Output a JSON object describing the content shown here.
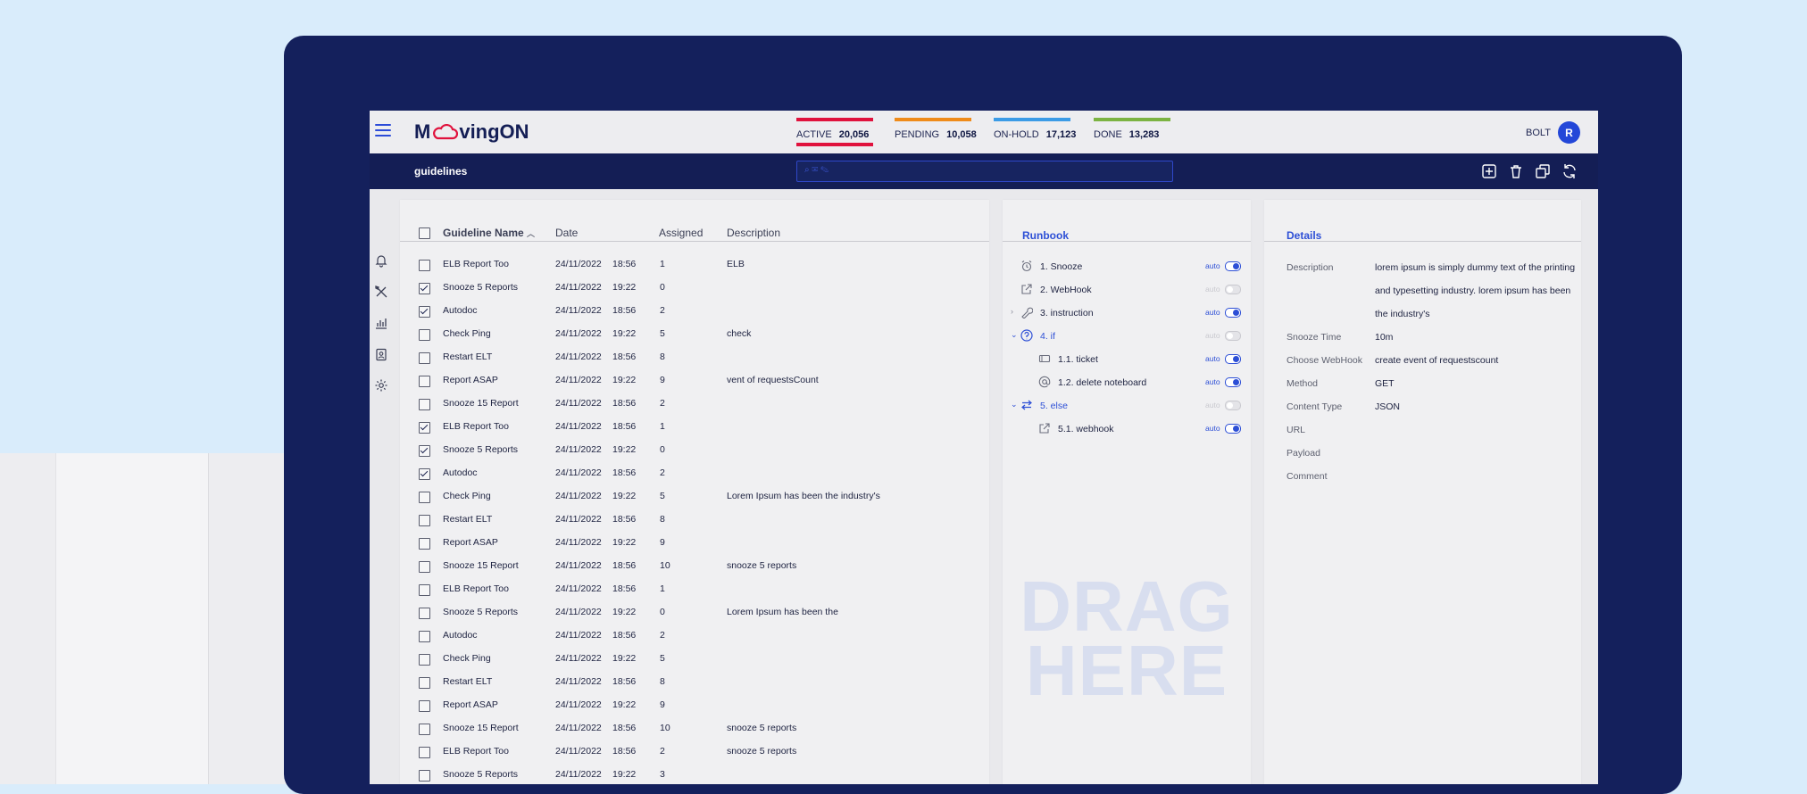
{
  "app": {
    "logo_left": "M",
    "logo_right": "vingON",
    "user": "BOLT",
    "avatar_initial": "R"
  },
  "stats": [
    {
      "label": "ACTIVE",
      "value": "20,056",
      "color": "#e0123d"
    },
    {
      "label": "PENDING",
      "value": "10,058",
      "color": "#ef8b1a"
    },
    {
      "label": "ON-HOLD",
      "value": "17,123",
      "color": "#3b9be6"
    },
    {
      "label": "DONE",
      "value": "13,283",
      "color": "#7cb342"
    }
  ],
  "subbar": {
    "title": "guidelines",
    "search_placeholder": "⌕ ✉ ✎"
  },
  "table": {
    "headers": {
      "name": "Guideline Name",
      "date": "Date",
      "assigned": "Assigned",
      "description": "Description"
    },
    "rows": [
      {
        "name": "ELB Report Too",
        "date": "24/11/2022",
        "time": "18:56",
        "assigned": "1",
        "description": "ELB",
        "checked": false
      },
      {
        "name": "Snooze 5 Reports",
        "date": "24/11/2022",
        "time": "19:22",
        "assigned": "0",
        "description": "",
        "checked": true
      },
      {
        "name": "Autodoc",
        "date": "24/11/2022",
        "time": "18:56",
        "assigned": "2",
        "description": "",
        "checked": true
      },
      {
        "name": "Check Ping",
        "date": "24/11/2022",
        "time": "19:22",
        "assigned": "5",
        "description": "check",
        "checked": false
      },
      {
        "name": "Restart ELT",
        "date": "24/11/2022",
        "time": "18:56",
        "assigned": "8",
        "description": "",
        "checked": false
      },
      {
        "name": "Report ASAP",
        "date": "24/11/2022",
        "time": "19:22",
        "assigned": "9",
        "description": "vent of requestsCount",
        "checked": false
      },
      {
        "name": "Snooze 15 Report",
        "date": "24/11/2022",
        "time": "18:56",
        "assigned": "2",
        "description": "",
        "checked": false
      },
      {
        "name": "ELB Report Too",
        "date": "24/11/2022",
        "time": "18:56",
        "assigned": "1",
        "description": "",
        "checked": true
      },
      {
        "name": "Snooze 5 Reports",
        "date": "24/11/2022",
        "time": "19:22",
        "assigned": "0",
        "description": "",
        "checked": true
      },
      {
        "name": "Autodoc",
        "date": "24/11/2022",
        "time": "18:56",
        "assigned": "2",
        "description": "",
        "checked": true
      },
      {
        "name": "Check Ping",
        "date": "24/11/2022",
        "time": "19:22",
        "assigned": "5",
        "description": " Lorem Ipsum has been the industry's",
        "checked": false
      },
      {
        "name": "Restart ELT",
        "date": "24/11/2022",
        "time": "18:56",
        "assigned": "8",
        "description": "",
        "checked": false
      },
      {
        "name": "Report ASAP",
        "date": "24/11/2022",
        "time": "19:22",
        "assigned": "9",
        "description": "",
        "checked": false
      },
      {
        "name": "Snooze 15 Report",
        "date": "24/11/2022",
        "time": "18:56",
        "assigned": "10",
        "description": "snooze 5 reports",
        "checked": false
      },
      {
        "name": "ELB Report Too",
        "date": "24/11/2022",
        "time": "18:56",
        "assigned": "1",
        "description": "",
        "checked": false
      },
      {
        "name": "Snooze 5 Reports",
        "date": "24/11/2022",
        "time": "19:22",
        "assigned": "0",
        "description": "Lorem Ipsum has been the",
        "checked": false
      },
      {
        "name": "Autodoc",
        "date": "24/11/2022",
        "time": "18:56",
        "assigned": "2",
        "description": "",
        "checked": false
      },
      {
        "name": "Check Ping",
        "date": "24/11/2022",
        "time": "19:22",
        "assigned": "5",
        "description": "",
        "checked": false
      },
      {
        "name": "Restart ELT",
        "date": "24/11/2022",
        "time": "18:56",
        "assigned": "8",
        "description": "",
        "checked": false
      },
      {
        "name": "Report ASAP",
        "date": "24/11/2022",
        "time": "19:22",
        "assigned": "9",
        "description": "",
        "checked": false
      },
      {
        "name": "Snooze 15 Report",
        "date": "24/11/2022",
        "time": "18:56",
        "assigned": "10",
        "description": "snooze 5 reports",
        "checked": false
      },
      {
        "name": "ELB Report Too",
        "date": "24/11/2022",
        "time": "18:56",
        "assigned": "2",
        "description": "snooze 5 reports",
        "checked": false
      },
      {
        "name": "Snooze 5 Reports",
        "date": "24/11/2022",
        "time": "19:22",
        "assigned": "3",
        "description": "",
        "checked": false
      }
    ]
  },
  "runbook": {
    "title": "Runbook",
    "steps": [
      {
        "label": "1. Snooze",
        "icon": "alarm-clock-icon",
        "auto": "auto",
        "enabled": true,
        "level": 0,
        "caret": "",
        "blue": false
      },
      {
        "label": "2. WebHook",
        "icon": "external-link-icon",
        "auto": "auto",
        "enabled": false,
        "level": 0,
        "caret": "",
        "blue": false
      },
      {
        "label": "3. instruction",
        "icon": "wrench-icon",
        "auto": "auto",
        "enabled": true,
        "level": 0,
        "caret": "›",
        "blue": false
      },
      {
        "label": "4. if",
        "icon": "question-circle-icon",
        "auto": "auto",
        "enabled": false,
        "level": 0,
        "caret": "⌄",
        "blue": true
      },
      {
        "label": "1.1. ticket",
        "icon": "ticket-icon",
        "auto": "auto",
        "enabled": true,
        "level": 1,
        "caret": "",
        "blue": false
      },
      {
        "label": "1.2. delete noteboard",
        "icon": "at-sign-icon",
        "auto": "auto",
        "enabled": true,
        "level": 1,
        "caret": "",
        "blue": false
      },
      {
        "label": "5. else",
        "icon": "swap-arrows-icon",
        "auto": "auto",
        "enabled": false,
        "level": 0,
        "caret": "⌄",
        "blue": true
      },
      {
        "label": "5.1. webhook",
        "icon": "external-link-icon",
        "auto": "auto",
        "enabled": true,
        "level": 1,
        "caret": "",
        "blue": false
      }
    ],
    "drag_line1": "DRAG",
    "drag_line2": "HERE"
  },
  "details": {
    "title": "Details",
    "fields": [
      {
        "label": "Description",
        "value": "lorem ipsum is simply dummy text of the printing and typesetting industry. lorem ipsum has been the industry's"
      },
      {
        "label": "Snooze Time",
        "value": "10m"
      },
      {
        "label": "Choose WebHook",
        "value": "create event of requestscount"
      },
      {
        "label": "Method",
        "value": "GET"
      },
      {
        "label": "Content Type",
        "value": "JSON"
      },
      {
        "label": "URL",
        "value": ""
      },
      {
        "label": "Payload",
        "value": ""
      },
      {
        "label": "Comment",
        "value": ""
      }
    ]
  }
}
